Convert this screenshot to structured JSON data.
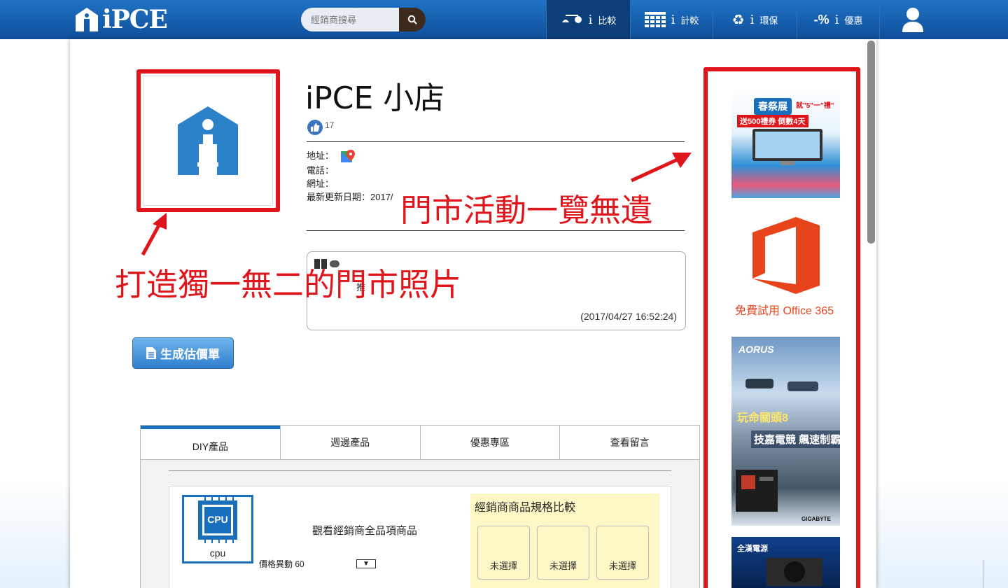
{
  "header": {
    "logo_text": "iPCE",
    "search_placeholder": "經銷商搜尋",
    "nav": [
      {
        "icon": "scale-icon",
        "i": "i",
        "label": "比較"
      },
      {
        "icon": "calculator-icon",
        "i": "i",
        "label": "計較"
      },
      {
        "icon": "recycle-icon",
        "i": "i",
        "label": "環保"
      },
      {
        "icon": "discount-icon",
        "icon_text": "-%",
        "i": "i",
        "label": "優惠"
      }
    ]
  },
  "store": {
    "title": "iPCE 小店",
    "likes": "17",
    "address_label": "地址：",
    "phone_label": "電話：",
    "website_label": "網址：",
    "updated_label": "最新更新日期：2017/",
    "message_stub": "推",
    "message_time": "(2017/04/27 16:52:24)",
    "estimate_button": "生成估價單"
  },
  "tabs": [
    "DIY產品",
    "週邊產品",
    "優惠專區",
    "查看留言"
  ],
  "product": {
    "chip_text": "CPU",
    "label": "cpu",
    "view_all": "觀看經銷商全品項商品",
    "price_change": "價格異動 60",
    "compare_title": "經銷商商品規格比較",
    "slots": [
      "未選擇",
      "未選擇",
      "未選擇"
    ]
  },
  "ads": {
    "ad1_title": "春祭展",
    "ad1_sub": "就\"5\"一\"禮\"",
    "ad1_promo": "送500禮券 倒數4天",
    "ad2_caption": "免費試用 Office 365",
    "ad3_brand": "AORUS",
    "ad3_title": "玩命關頭8",
    "ad3_sub": "技嘉電競 飆速制霸",
    "ad3_brand_footer": "GIGABYTE",
    "ad4_brand": "全漢電源"
  },
  "annotations": {
    "activities": "門市活動一覽無遺",
    "photo": "打造獨一無二的門市照片"
  },
  "colors": {
    "header_blue": "#1a62b4",
    "annotation_red": "#e0151b",
    "brand_blue": "#1a6fbd",
    "compare_yellow": "#fdf8c6"
  }
}
